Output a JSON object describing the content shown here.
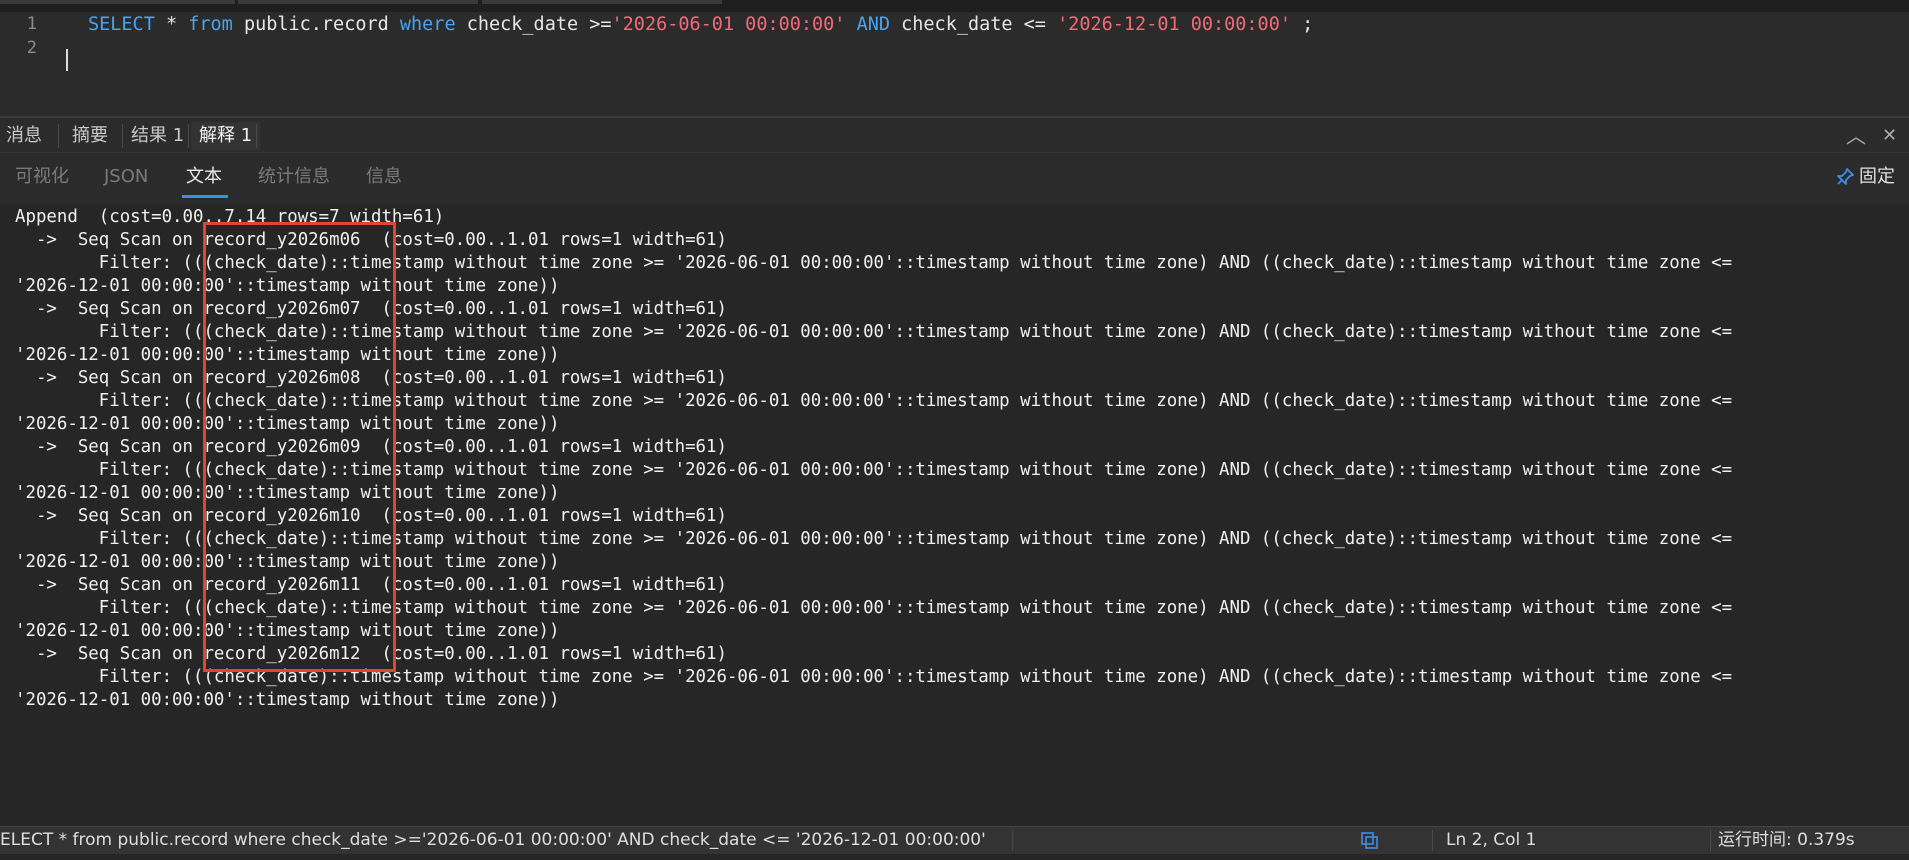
{
  "editor": {
    "line_numbers": [
      "1",
      "2"
    ],
    "code": {
      "kw_select": "SELECT",
      "star": " * ",
      "kw_from": "from",
      "table": " public.record ",
      "kw_where": "where",
      "cond1": " check_date >=",
      "date1": "'2026-06-01 00:00:00'",
      "space": " ",
      "kw_and": "AND",
      "cond2": " check_date <= ",
      "date2": "'2026-12-01 00:00:00'",
      "tail": " ;"
    }
  },
  "panel_tabs": [
    "消息",
    "摘要",
    "结果 1",
    "解释 1"
  ],
  "panel_controls": {
    "collapse": "︿",
    "close": "✕"
  },
  "sub_tabs": [
    "可视化",
    "JSON",
    "文本",
    "统计信息",
    "信息"
  ],
  "pin_label": "固定",
  "plan_lines": [
    "Append  (cost=0.00..7.14 rows=7 width=61)",
    "  ->  Seq Scan on record_y2026m06  (cost=0.00..1.01 rows=1 width=61)",
    "        Filter: (((check_date)::timestamp without time zone >= '2026-06-01 00:00:00'::timestamp without time zone) AND ((check_date)::timestamp without time zone <=",
    "'2026-12-01 00:00:00'::timestamp without time zone))",
    "  ->  Seq Scan on record_y2026m07  (cost=0.00..1.01 rows=1 width=61)",
    "        Filter: (((check_date)::timestamp without time zone >= '2026-06-01 00:00:00'::timestamp without time zone) AND ((check_date)::timestamp without time zone <=",
    "'2026-12-01 00:00:00'::timestamp without time zone))",
    "  ->  Seq Scan on record_y2026m08  (cost=0.00..1.01 rows=1 width=61)",
    "        Filter: (((check_date)::timestamp without time zone >= '2026-06-01 00:00:00'::timestamp without time zone) AND ((check_date)::timestamp without time zone <=",
    "'2026-12-01 00:00:00'::timestamp without time zone))",
    "  ->  Seq Scan on record_y2026m09  (cost=0.00..1.01 rows=1 width=61)",
    "        Filter: (((check_date)::timestamp without time zone >= '2026-06-01 00:00:00'::timestamp without time zone) AND ((check_date)::timestamp without time zone <=",
    "'2026-12-01 00:00:00'::timestamp without time zone))",
    "  ->  Seq Scan on record_y2026m10  (cost=0.00..1.01 rows=1 width=61)",
    "        Filter: (((check_date)::timestamp without time zone >= '2026-06-01 00:00:00'::timestamp without time zone) AND ((check_date)::timestamp without time zone <=",
    "'2026-12-01 00:00:00'::timestamp without time zone))",
    "  ->  Seq Scan on record_y2026m11  (cost=0.00..1.01 rows=1 width=61)",
    "        Filter: (((check_date)::timestamp without time zone >= '2026-06-01 00:00:00'::timestamp without time zone) AND ((check_date)::timestamp without time zone <=",
    "'2026-12-01 00:00:00'::timestamp without time zone))",
    "  ->  Seq Scan on record_y2026m12  (cost=0.00..1.01 rows=1 width=61)",
    "        Filter: (((check_date)::timestamp without time zone >= '2026-06-01 00:00:00'::timestamp without time zone) AND ((check_date)::timestamp without time zone <=",
    "'2026-12-01 00:00:00'::timestamp without time zone))"
  ],
  "status": {
    "query": "ELECT * from public.record where check_date >='2026-06-01 00:00:00' AND check_date <= '2026-12-01 00:00:00'",
    "position": "Ln 2, Col 1",
    "runtime": "运行时间: 0.379s"
  },
  "colors": {
    "keyword": "#4aa3f0",
    "string": "#f06a77",
    "accent": "#3d8ee8",
    "highlight_box": "#e0452f"
  }
}
